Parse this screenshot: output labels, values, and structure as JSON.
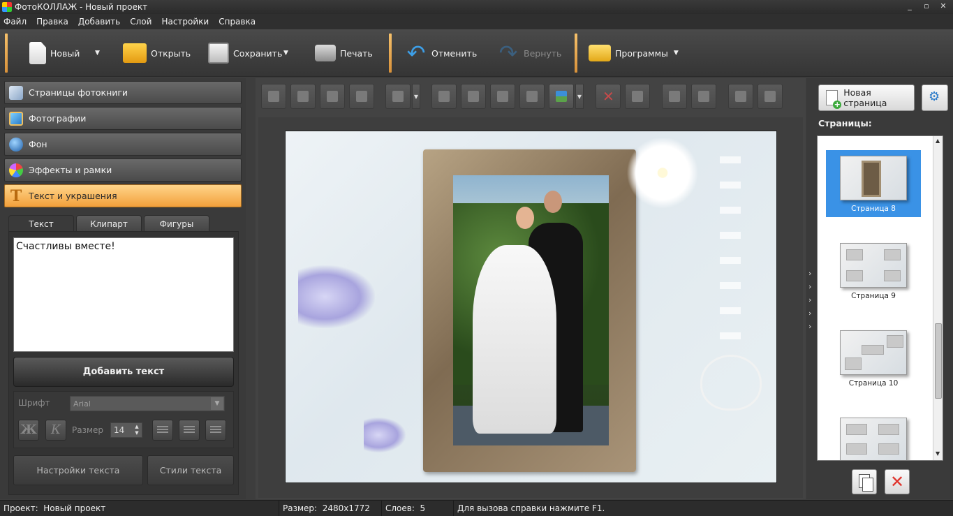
{
  "window": {
    "title": "ФотоКОЛЛАЖ - Новый проект",
    "minimize_glyph": "_",
    "maximize_glyph": "▫",
    "close_glyph": "✕"
  },
  "menu": [
    "Файл",
    "Правка",
    "Добавить",
    "Слой",
    "Настройки",
    "Справка"
  ],
  "toolbar": {
    "new_label": "Новый",
    "open_label": "Открыть",
    "save_label": "Сохранить",
    "print_label": "Печать",
    "undo_label": "Отменить",
    "redo_label": "Вернуть",
    "programs_label": "Программы",
    "dropdown_glyph": "▼",
    "undo_glyph": "↶",
    "redo_glyph": "↷"
  },
  "left_panel": {
    "sections": [
      {
        "label": "Страницы фотокниги",
        "icon": "book-icon"
      },
      {
        "label": "Фотографии",
        "icon": "photo-icon"
      },
      {
        "label": "Фон",
        "icon": "background-icon"
      },
      {
        "label": "Эффекты и рамки",
        "icon": "palette-icon"
      },
      {
        "label": "Текст и украшения",
        "icon": "text-icon",
        "active": true
      }
    ],
    "text_icon_glyph": "T",
    "tabs": [
      "Текст",
      "Клипарт",
      "Фигуры"
    ],
    "active_tab": "Текст",
    "text_value": "Счастливы вместе!",
    "add_text_button": "Добавить текст",
    "font_label": "Шрифт",
    "font_value": "Arial",
    "bold_glyph": "Ж",
    "italic_glyph": "К",
    "size_label": "Размер",
    "size_value": "14",
    "spin_up": "▲",
    "spin_down": "▼",
    "text_settings_button": "Настройки текста",
    "text_styles_button": "Стили текста"
  },
  "right_panel": {
    "new_page_button": "Новая страница",
    "pages_label": "Страницы:",
    "pages": [
      {
        "caption": "Страница 8",
        "selected": true
      },
      {
        "caption": "Страница 9",
        "selected": false
      },
      {
        "caption": "Страница 10",
        "selected": false
      }
    ],
    "scroll_up": "▲",
    "scroll_down": "▼",
    "delete_glyph": "✕"
  },
  "splitter_glyph": "›",
  "status": {
    "project": "Проект:  Новый проект",
    "size": "Размер:  2480x1772",
    "layers": "Слоев:  5",
    "help": "Для вызова справки нажмите F1."
  },
  "colors": {
    "accent_orange": "#f2a03b",
    "selected_blue": "#3a92e6",
    "delete_red": "#e0322b"
  }
}
